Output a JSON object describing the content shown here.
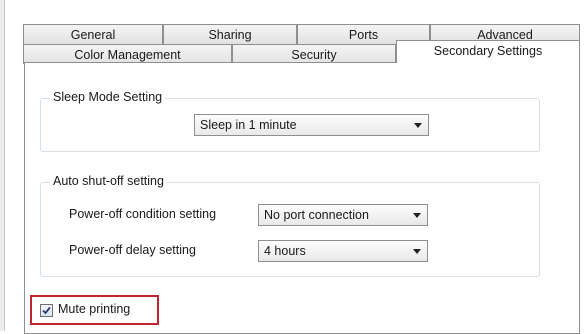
{
  "tabs": {
    "row1": [
      "General",
      "Sharing",
      "Ports",
      "Advanced"
    ],
    "row2": [
      "Color Management",
      "Security",
      "Secondary Settings"
    ],
    "active": "Secondary Settings"
  },
  "sleep_group": {
    "title": "Sleep Mode Setting",
    "sleep_select": {
      "value": "Sleep in 1 minute"
    }
  },
  "shutoff_group": {
    "title": "Auto shut-off setting",
    "condition_label": "Power-off condition setting",
    "condition_select": {
      "value": "No port connection"
    },
    "delay_label": "Power-off delay setting",
    "delay_select": {
      "value": "4 hours"
    }
  },
  "mute": {
    "label": "Mute printing",
    "checked": true
  },
  "colors": {
    "highlight_border": "#c0262d",
    "tab_border": "#8e8f8f",
    "group_border": "#d5dfe5",
    "checkmark": "#2b3f6e"
  },
  "icons": {
    "dropdown": "chevron-down-icon",
    "check": "checkmark-icon"
  }
}
